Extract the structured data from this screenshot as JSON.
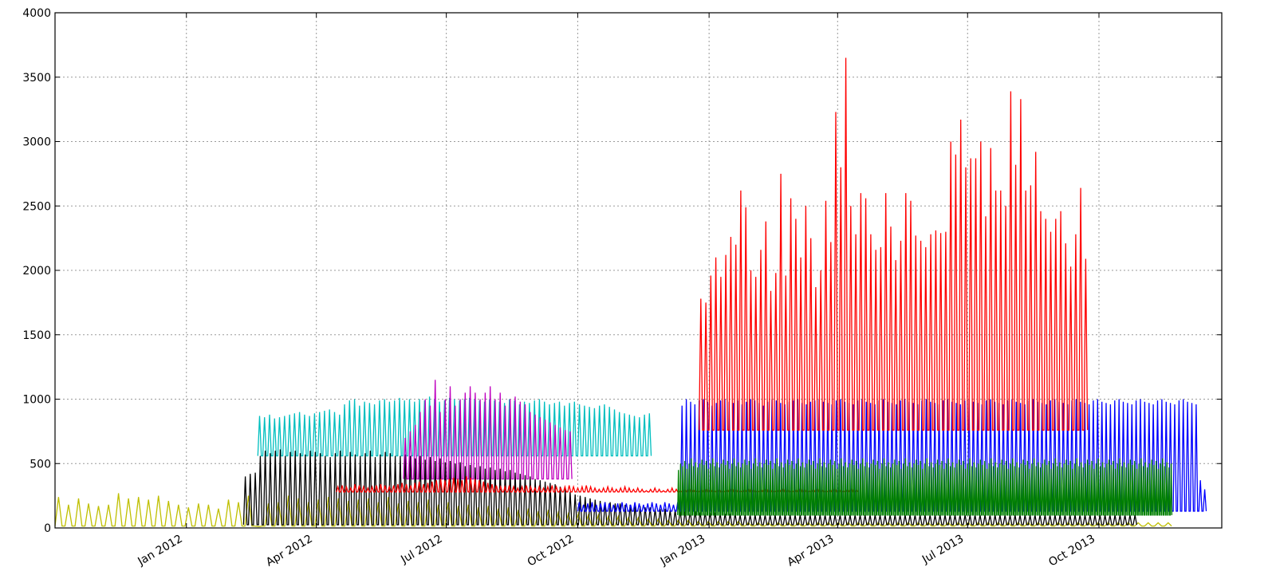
{
  "chart_data": {
    "type": "line",
    "title": "",
    "xlabel": "",
    "ylabel": "",
    "xlim": [
      "2011-10-01",
      "2013-12-26"
    ],
    "ylim": [
      0,
      4000
    ],
    "grid": true,
    "y_ticks": [
      0,
      500,
      1000,
      1500,
      2000,
      2500,
      3000,
      3500,
      4000
    ],
    "x_ticks": [
      {
        "date": "2012-01-01",
        "label": "Jan 2012"
      },
      {
        "date": "2012-04-01",
        "label": "Apr 2012"
      },
      {
        "date": "2012-07-01",
        "label": "Jul 2012"
      },
      {
        "date": "2012-10-01",
        "label": "Oct 2012"
      },
      {
        "date": "2013-01-01",
        "label": "Jan 2013"
      },
      {
        "date": "2013-04-01",
        "label": "Apr 2013"
      },
      {
        "date": "2013-07-01",
        "label": "Jul 2013"
      },
      {
        "date": "2013-10-01",
        "label": "Oct 2013"
      }
    ],
    "series": [
      {
        "color": "#bfbf00",
        "start": "2011-10-01",
        "end": "2013-11-20",
        "base": 15,
        "step_days": 7,
        "peaks": [
          240,
          180,
          230,
          190,
          170,
          180,
          270,
          230,
          240,
          220,
          250,
          210,
          180,
          160,
          190,
          180,
          150,
          220,
          200,
          250,
          10,
          190,
          200,
          250,
          230,
          200,
          220,
          240,
          230,
          210,
          220,
          230,
          200,
          240,
          190,
          210,
          200,
          220,
          180,
          200,
          170,
          180,
          160,
          170,
          150,
          160,
          140,
          150,
          130,
          140,
          120,
          110,
          110,
          100,
          100,
          90,
          90,
          80,
          80,
          70,
          70,
          60,
          60,
          60,
          50,
          50,
          50,
          50,
          50,
          40,
          40,
          40,
          40,
          40,
          40,
          40,
          40,
          40,
          40,
          40,
          40,
          40,
          40,
          40,
          40,
          40,
          40,
          40,
          40,
          40,
          40,
          40,
          40,
          40,
          40,
          40,
          40,
          40,
          40,
          40,
          40,
          40,
          40,
          40,
          40,
          40,
          40,
          40,
          40,
          40,
          40,
          40
        ]
      },
      {
        "color": "#00bfbf",
        "start": "2012-02-20",
        "end": "2012-11-20",
        "base": 560,
        "step_days": 3.5,
        "peaks": [
          870,
          860,
          880,
          850,
          860,
          870,
          880,
          890,
          900,
          880,
          870,
          890,
          900,
          910,
          920,
          900,
          880,
          960,
          990,
          1000,
          950,
          980,
          970,
          960,
          990,
          1000,
          980,
          990,
          1010,
          990,
          1000,
          980,
          1000,
          990,
          1020,
          1000,
          980,
          990,
          1010,
          1000,
          990,
          1000,
          1010,
          1000,
          990,
          980,
          1000,
          990,
          980,
          970,
          1000,
          990,
          960,
          980,
          970,
          990,
          1000,
          980,
          960,
          970,
          980,
          950,
          970,
          980,
          960,
          950,
          940,
          930,
          950,
          960,
          940,
          920,
          900,
          890,
          880,
          870,
          860,
          880,
          890,
          900,
          850,
          860
        ]
      },
      {
        "color": "#000000",
        "start": "2012-02-10",
        "end": "2013-11-20",
        "base": 25,
        "step_days": 3.5,
        "peaks": [
          400,
          420,
          430,
          560,
          600,
          580,
          600,
          610,
          560,
          590,
          600,
          580,
          570,
          600,
          590,
          580,
          560,
          550,
          580,
          600,
          560,
          590,
          570,
          560,
          580,
          600,
          550,
          570,
          590,
          580,
          560,
          560,
          570,
          560,
          540,
          560,
          530,
          550,
          520,
          540,
          510,
          520,
          500,
          510,
          480,
          490,
          470,
          480,
          460,
          470,
          450,
          460,
          440,
          450,
          430,
          420,
          410,
          400,
          380,
          370,
          360,
          350,
          340,
          320,
          300,
          280,
          260,
          250,
          240,
          230,
          220,
          210,
          200,
          200,
          190,
          190,
          180,
          180,
          170,
          170,
          160,
          160,
          150,
          150,
          150,
          140,
          140,
          140,
          130,
          130,
          130,
          120,
          120,
          120,
          120,
          110,
          110,
          110,
          110,
          100,
          100,
          100,
          100,
          100,
          100,
          100,
          100,
          100,
          100,
          100,
          100,
          100,
          100,
          100,
          100,
          100,
          100,
          100,
          100,
          100,
          100,
          100,
          100,
          100,
          100,
          100,
          100,
          100,
          100,
          100,
          100,
          100,
          100,
          100,
          100,
          100,
          100,
          100,
          100,
          100,
          100,
          100,
          100,
          100,
          100,
          100,
          100,
          100,
          100,
          100,
          100,
          100,
          100,
          100,
          100,
          100,
          100,
          100,
          100,
          100,
          100,
          100,
          100,
          100,
          100,
          100,
          100,
          100,
          100,
          100,
          100,
          100,
          100,
          100,
          100,
          100,
          100,
          100,
          100
        ]
      },
      {
        "color": "#bf00bf",
        "start": "2012-06-01",
        "end": "2012-10-01",
        "base": 380,
        "step_days": 3.5,
        "peaks": [
          700,
          750,
          800,
          900,
          1000,
          950,
          1150,
          900,
          1000,
          1100,
          950,
          1000,
          1050,
          1100,
          1050,
          1000,
          1050,
          1100,
          1000,
          1050,
          950,
          1000,
          1020,
          980,
          960,
          900,
          880,
          860,
          840,
          820,
          800,
          780,
          760,
          750
        ]
      },
      {
        "color": "#ff0000",
        "start": "2012-04-15",
        "end": "2013-04-25",
        "base": 280,
        "step_days": 3,
        "peaks": [
          320,
          330,
          320,
          310,
          340,
          330,
          320,
          310,
          320,
          330,
          340,
          330,
          320,
          330,
          340,
          350,
          340,
          330,
          350,
          360,
          340,
          350,
          360,
          370,
          380,
          370,
          380,
          390,
          380,
          370,
          400,
          390,
          380,
          370,
          360,
          350,
          340,
          330,
          320,
          320,
          330,
          320,
          310,
          320,
          330,
          320,
          310,
          320,
          310,
          320,
          330,
          320,
          310,
          320,
          330,
          320,
          310,
          320,
          330,
          320,
          310,
          300,
          310,
          320,
          310,
          300,
          310,
          320,
          310,
          300,
          310,
          300,
          290,
          300,
          310,
          300,
          290,
          300,
          310,
          300,
          290,
          300,
          310,
          300,
          290,
          300,
          310,
          300,
          290,
          300,
          290,
          300,
          310,
          300,
          290,
          300,
          310,
          300,
          290,
          300,
          310,
          300,
          290,
          300,
          310,
          300,
          290,
          300,
          310,
          300,
          290,
          300,
          310,
          300,
          290,
          300,
          310,
          300,
          290,
          300,
          310,
          300
        ]
      },
      {
        "color": "#0000ff",
        "start": "2012-10-01",
        "end": "2013-12-26",
        "base": 130,
        "step_days": 3,
        "peaks": [
          200,
          180,
          190,
          200,
          180,
          190,
          200,
          190,
          180,
          190,
          200,
          190,
          180,
          200,
          190,
          180,
          190,
          200,
          190,
          180,
          200,
          190,
          180,
          200,
          950,
          1000,
          980,
          960,
          990,
          1000,
          980,
          950,
          970,
          990,
          1000,
          980,
          970,
          990,
          960,
          980,
          1000,
          990,
          970,
          950,
          980,
          1000,
          990,
          970,
          960,
          980,
          990,
          1000,
          970,
          960,
          980,
          990,
          1000,
          980,
          970,
          960,
          990,
          1000,
          980,
          970,
          960,
          990,
          1000,
          980,
          970,
          960,
          990,
          1000,
          980,
          970,
          960,
          990,
          1000,
          980,
          970,
          960,
          990,
          1000,
          980,
          970,
          960,
          990,
          1000,
          980,
          970,
          960,
          990,
          1000,
          980,
          970,
          960,
          990,
          1000,
          980,
          970,
          960,
          990,
          1000,
          980,
          970,
          960,
          990,
          1000,
          980,
          970,
          960,
          990,
          1000,
          980,
          970,
          960,
          990,
          1000,
          980,
          970,
          960,
          990,
          1000,
          980,
          970,
          960,
          990,
          1000,
          980,
          970,
          960,
          990,
          1000,
          980,
          970,
          960,
          990,
          1000,
          980,
          970,
          960,
          990,
          1000,
          980,
          970,
          960,
          370,
          300
        ]
      },
      {
        "color": "#007f00",
        "start": "2012-12-10",
        "end": "2013-11-30",
        "base": 100,
        "step_days": 1.5,
        "peaks": [
          450,
          500,
          480,
          520,
          460,
          500,
          540,
          480,
          510,
          470,
          500,
          530,
          490,
          520,
          460,
          500,
          540,
          480,
          510,
          470,
          500,
          530,
          490,
          520,
          460,
          500,
          540,
          480,
          510,
          470,
          500,
          530,
          490,
          520,
          460,
          500,
          540,
          480,
          510,
          470,
          500,
          530,
          490,
          520,
          460,
          500,
          540,
          480,
          510,
          470,
          500,
          530,
          490,
          520,
          460,
          500,
          540,
          480,
          510,
          470,
          500,
          530,
          490,
          520,
          460,
          500,
          540,
          480,
          510,
          470,
          500,
          530,
          490,
          520,
          460,
          500,
          540,
          480,
          510,
          470,
          500,
          530,
          490,
          520,
          460,
          500,
          540,
          480,
          510,
          470,
          500,
          530,
          490,
          520,
          460,
          500,
          540,
          480,
          510,
          470,
          500,
          530,
          490,
          520,
          460,
          500,
          540,
          480,
          510,
          470,
          500,
          530,
          490,
          520,
          460,
          500,
          540,
          480,
          510,
          470,
          500,
          530,
          490,
          520,
          460,
          500,
          540,
          480,
          510,
          470,
          500,
          530,
          490,
          520,
          460,
          500,
          540,
          480,
          510,
          470,
          500,
          530,
          490,
          520,
          460,
          500,
          540,
          480,
          510,
          470,
          500,
          530,
          490,
          520,
          460,
          500,
          540,
          480,
          510,
          470,
          500,
          530,
          490,
          520,
          460,
          500,
          540,
          480,
          510,
          470,
          500,
          530,
          490,
          520,
          460,
          500,
          540,
          480,
          510,
          470,
          500,
          530,
          490,
          520,
          460,
          500,
          540,
          480,
          510,
          470,
          500,
          530,
          490,
          520,
          460,
          500,
          540,
          480,
          510,
          470,
          500,
          530,
          490,
          520,
          460,
          500,
          540,
          480,
          510,
          470,
          500,
          530,
          490,
          520,
          460,
          500,
          540,
          480,
          510,
          470,
          500,
          530,
          490,
          520,
          460,
          500,
          540,
          480,
          510,
          470,
          500
        ]
      },
      {
        "color": "#ff0000",
        "start": "2012-12-25",
        "end": "2013-12-26",
        "base": 760,
        "step_days": 3.5,
        "peaks": [
          1780,
          1750,
          1960,
          2100,
          1950,
          2120,
          2260,
          2200,
          2620,
          2490,
          2000,
          1950,
          2160,
          2380,
          1840,
          1980,
          2750,
          1960,
          2560,
          2400,
          2100,
          2500,
          2250,
          1870,
          2000,
          2540,
          2220,
          3230,
          2800,
          3650,
          2500,
          2280,
          2600,
          2560,
          2280,
          2160,
          2180,
          2600,
          2340,
          2080,
          2230,
          2600,
          2540,
          2270,
          2230,
          2180,
          2280,
          2310,
          2290,
          2300,
          3000,
          2900,
          3170,
          2800,
          2870,
          2870,
          3000,
          2420,
          2950,
          2620,
          2620,
          2500,
          3390,
          2820,
          3330,
          2620,
          2660,
          2920,
          2460,
          2400,
          2300,
          2400,
          2460,
          2210,
          2030,
          2280,
          2640,
          2090
        ]
      }
    ]
  }
}
